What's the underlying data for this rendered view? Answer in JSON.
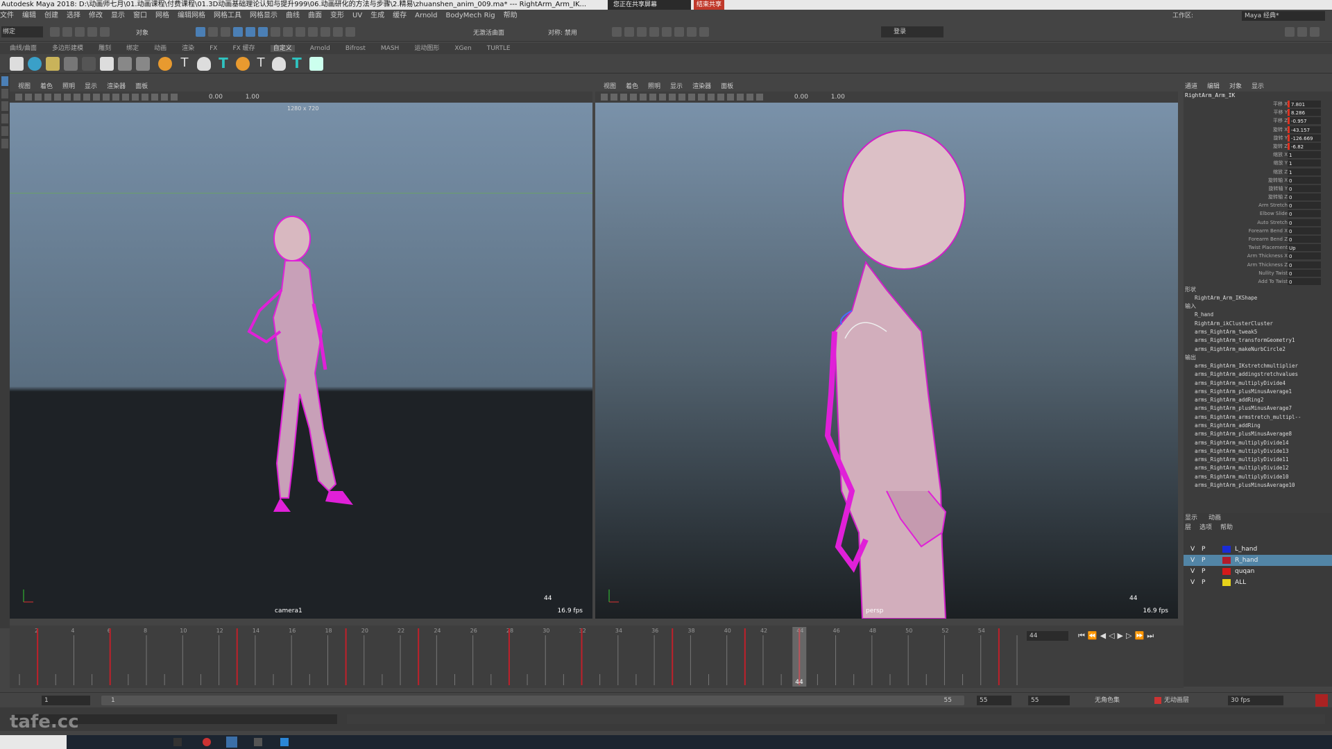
{
  "window": {
    "title": "Autodesk Maya 2018: D:\\动画师七月\\01.动画课程\\付费课程\\01.3D动画基础理论认知与提升999\\06.动画研化的方法与步骤\\2.精易\\zhuanshen_anim_009.ma*  ---  RightArm_Arm_IK...",
    "share_label": "您正在共享屏幕",
    "share_stop": "结束共享",
    "workspace_label": "工作区:",
    "workspace_value": "Maya 经典*"
  },
  "menubar": [
    "文件",
    "编辑",
    "创建",
    "选择",
    "修改",
    "显示",
    "窗口",
    "网格",
    "编辑网格",
    "网格工具",
    "网格显示",
    "曲线",
    "曲面",
    "变形",
    "UV",
    "生成",
    "缓存",
    "Arnold",
    "BodyMech Rig",
    "帮助"
  ],
  "statusline": {
    "mode": "绑定",
    "selection": "对象",
    "symmetry": "对称: 禁用",
    "live": "无激活曲面",
    "login": "登录"
  },
  "shelf_tabs": [
    "曲线/曲面",
    "多边形建模",
    "雕刻",
    "绑定",
    "动画",
    "渲染",
    "FX",
    "FX 缓存",
    "自定义",
    "Arnold",
    "Bifrost",
    "MASH",
    "运动图形",
    "XGen",
    "TURTLE"
  ],
  "shelf_active": "自定义",
  "shelf_icon_labels": [
    "大脑裂",
    "",
    "工具架",
    "ALL",
    "alFeng",
    "选择组",
    "选中组",
    "选择面"
  ],
  "viewports": [
    {
      "menu": [
        "视图",
        "着色",
        "照明",
        "显示",
        "渲染器",
        "面板"
      ],
      "near": "0.00",
      "far": "1.00",
      "resolution": "1280 x 720",
      "camera_label": "camera1",
      "frame": "44",
      "fps": "16.9 fps"
    },
    {
      "menu": [
        "视图",
        "着色",
        "照明",
        "显示",
        "渲染器",
        "面板"
      ],
      "near": "0.00",
      "far": "1.00",
      "camera_label": "persp",
      "frame": "44",
      "fps": "16.9 fps"
    }
  ],
  "channel_box": {
    "tabs": [
      "通道",
      "编辑",
      "对象",
      "显示"
    ],
    "object": "RightArm_Arm_IK",
    "attributes": [
      {
        "name": "平移 X",
        "value": "7.801"
      },
      {
        "name": "平移 Y",
        "value": "8.286"
      },
      {
        "name": "平移 Z",
        "value": "-0.957"
      },
      {
        "name": "旋转 X",
        "value": "-43.157"
      },
      {
        "name": "旋转 Y",
        "value": "-126.669"
      },
      {
        "name": "旋转 Z",
        "value": "-6.82"
      },
      {
        "name": "缩放 X",
        "value": "1"
      },
      {
        "name": "缩放 Y",
        "value": "1"
      },
      {
        "name": "缩放 Z",
        "value": "1"
      },
      {
        "name": "旋转轴 X",
        "value": "0"
      },
      {
        "name": "旋转轴 Y",
        "value": "0"
      },
      {
        "name": "旋转轴 Z",
        "value": "0"
      },
      {
        "name": "Arm Stretch",
        "value": "0"
      },
      {
        "name": "Elbow Slide",
        "value": "0"
      },
      {
        "name": "Auto Stretch",
        "value": "0"
      },
      {
        "name": "Forearm Bend X",
        "value": "0"
      },
      {
        "name": "Forearm Bend Z",
        "value": "0"
      },
      {
        "name": "Twist Placement",
        "value": "Up"
      },
      {
        "name": "Arm Thickness X",
        "value": "0"
      },
      {
        "name": "Arm Thickness Z",
        "value": "0"
      },
      {
        "name": "Nullity Twist",
        "value": "0"
      },
      {
        "name": "Add To Twist",
        "value": "0"
      }
    ],
    "shapes_header": "形状",
    "shape_name": "RightArm_Arm_IKShape",
    "inputs_header": "输入",
    "inputs": [
      "R_hand",
      "RightArm_ikClusterCluster",
      "arms_RightArm_tweak5",
      "arms_RightArm_transformGeometry1",
      "arms_RightArm_makeNurbCircle2"
    ],
    "outputs_header": "输出",
    "outputs": [
      "arms_RightArm_IKstretchmultiplier",
      "arms_RightArm_addingstretchvalues",
      "arms_RightArm_multiplyDivide4",
      "arms_RightArm_plusMinusAverage1",
      "arms_RightArm_addRing2",
      "arms_RightArm_plusMinusAverage7",
      "arms_RightArm_armstretch_multipl--",
      "arms_RightArm_addRing",
      "arms_RightArm_plusMinusAverage8",
      "arms_RightArm_multiplyDivide14",
      "arms_RightArm_multiplyDivide13",
      "arms_RightArm_multiplyDivide11",
      "arms_RightArm_multiplyDivide12",
      "arms_RightArm_multiplyDivide10",
      "arms_RightArm_plusMinusAverage10"
    ]
  },
  "layer_editor": {
    "tabs": [
      "显示",
      "动画"
    ],
    "menu": [
      "层",
      "选项",
      "帮助"
    ],
    "layers": [
      {
        "v": "V",
        "p": "P",
        "color": "#1a2bd6",
        "name": "L_hand",
        "selected": false
      },
      {
        "v": "V",
        "p": "P",
        "color": "#b31b2b",
        "name": "R_hand",
        "selected": true
      },
      {
        "v": "V",
        "p": "P",
        "color": "#d41a1a",
        "name": "quqan",
        "selected": false
      },
      {
        "v": "V",
        "p": "P",
        "color": "#e6d21a",
        "name": "ALL",
        "selected": false
      }
    ]
  },
  "timeline": {
    "ticks": [
      "2",
      "4",
      "6",
      "8",
      "10",
      "12",
      "14",
      "16",
      "18",
      "20",
      "22",
      "24",
      "26",
      "28",
      "30",
      "32",
      "34",
      "36",
      "38",
      "40",
      "42",
      "44",
      "46",
      "48",
      "50",
      "52",
      "54"
    ],
    "current_frame": "44",
    "keys": [
      2,
      6,
      13,
      19,
      23,
      28,
      32,
      37,
      41,
      44,
      55
    ],
    "current": 44,
    "start": 1,
    "end": 56
  },
  "playback": {
    "current_field": "44"
  },
  "range": {
    "start": "1",
    "range_start": "1",
    "range_end": "55",
    "anim_end": "55",
    "end": "55",
    "char_set": "无角色集",
    "anim_layer": "无动画层",
    "fps": "30 fps"
  },
  "watermark": "tafe.cc"
}
